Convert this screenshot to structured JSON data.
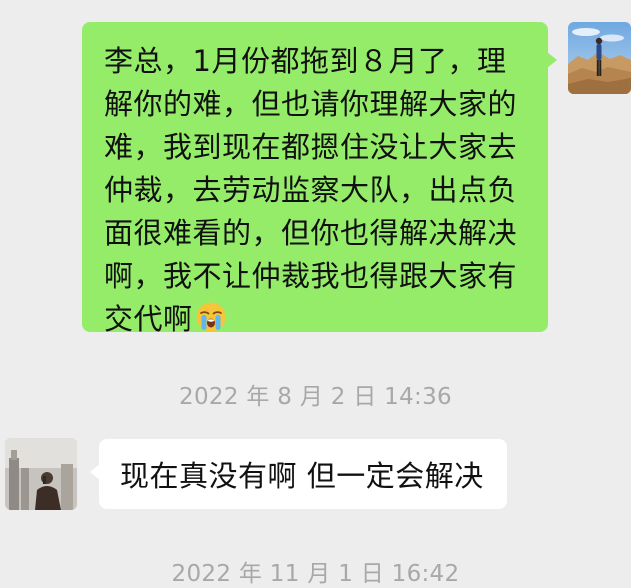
{
  "messages": [
    {
      "direction": "out",
      "text": "李总，1月份都拖到８月了，理解你的难，但也请你理解大家的难，我到现在都摁住没让大家去仲裁，去劳动监察大队，出点负面很难看的，但你也得解决解决啊，我不让仲裁我也得跟大家有交代啊",
      "emoji": "loudly-crying-face-emoji"
    },
    {
      "direction": "in",
      "text": "现在真没有啊 但一定会解决"
    }
  ],
  "timestamps": [
    "2022 年 8 月 2 日 14:36",
    "2022 年 11 月 1 日 16:42"
  ],
  "colors": {
    "background": "#ededed",
    "bubble_out": "#95ec69",
    "bubble_in": "#ffffff",
    "timestamp": "#a8a8a8"
  }
}
